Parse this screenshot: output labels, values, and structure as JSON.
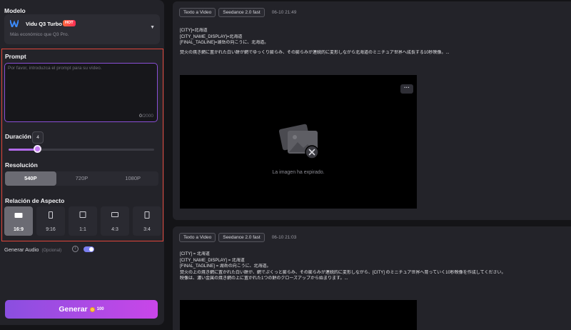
{
  "left_panel": {
    "model_section_label": "Modelo",
    "model": {
      "name": "Vidu Q3 Turbo",
      "badge": "HOT",
      "description": "Más económico que Q3 Pro."
    },
    "prompt_section_label": "Prompt",
    "prompt": {
      "value": "",
      "placeholder": "Por favor, introduzca el prompt para su vídeo.",
      "char_current": "0",
      "char_max": "/2000"
    },
    "duration": {
      "label": "Duración",
      "value": "4",
      "fraction": 0.2
    },
    "resolution": {
      "label": "Resolución",
      "options": [
        "540P",
        "720P",
        "1080P"
      ],
      "selected": "540P"
    },
    "aspect": {
      "label": "Relación de Aspecto",
      "options": [
        "16:9",
        "9:16",
        "1:1",
        "4:3",
        "3:4"
      ],
      "selected": "16:9"
    },
    "audio": {
      "label": "Generar Audio",
      "optional": "(Opcional)",
      "enabled": true
    },
    "generate": {
      "label": "Generar",
      "cost": "100"
    }
  },
  "history": [
    {
      "tags": [
        "Texto a Video",
        "Seedance 2.0 fast"
      ],
      "time": "06-10 21:49",
      "lines": [
        "[CITY]=北海道",
        "[CITY_NAME_DISPLAY]=北海道",
        "[FINAL_TAGLINE]=湖岳の向こうに、北海道。",
        "",
        "焚火の焼き網に置かれた白い餅が網でゆっくり膨らみ、その膨らみが連続的に変形しながら北海道のミニチュア世界へ成長する10秒映像。..."
      ],
      "status": "La imagen ha expirado.",
      "more_label": "···"
    },
    {
      "tags": [
        "Texto a Video",
        "Seedance 2.0 fast"
      ],
      "time": "06-10 21:03",
      "lines": [
        "[CITY] = 北海道",
        "[CITY_NAME_DISPLAY] = 北海道",
        "[FINAL_TAGLINE] = 湖岳の向こうに、北海道。",
        "焚火の上の焼き網に置かれた白い餅が、網でぷくっと膨らみ、その膨らみが連続的に変形しながら、[CITY] のミニチュア世界へ育っていく10秒映像を作成してください。",
        "映像は、濃い金属の焼き網の上に置かれた1つの餅のクローズアップから始まります。..."
      ]
    }
  ]
}
